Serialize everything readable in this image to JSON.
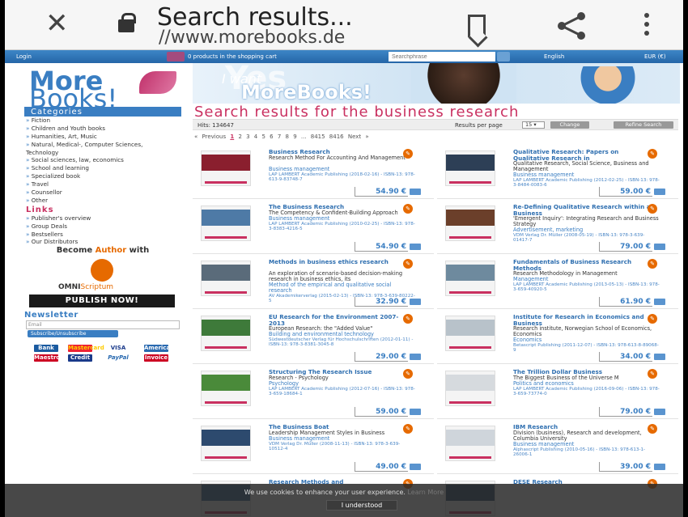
{
  "browser": {
    "title": "Search results...",
    "url": "//www.morebooks.de"
  },
  "topbar": {
    "login": "Login",
    "cart_text": "0 products in the shopping cart",
    "search_placeholder": "Searchphrase",
    "language": "English",
    "currency": "EUR (€)"
  },
  "logo": {
    "line1": "More",
    "line2": "Books!"
  },
  "banner": {
    "line1": "I want",
    "line2": "MoreBooks!",
    "bg_text": "Yes"
  },
  "sidebar": {
    "categories_title": "Categories",
    "categories": [
      "Fiction",
      "Children and Youth books",
      "Humanities, Art, Music",
      "Natural, Medical-, Computer Sciences, Technology",
      "Social sciences, law, economics",
      "School and learning",
      "Specialized book",
      "Travel",
      "Counsellor",
      "Other"
    ],
    "links_title": "Links",
    "links": [
      "Publisher's overview",
      "Group Deals",
      "Bestsellers",
      "Our Distributors"
    ],
    "become_prefix": "Become ",
    "become_accent": "Author",
    "become_suffix": " with",
    "omni_a": "OMNI",
    "omni_b": "Scriptum",
    "publish": "PUBLISH NOW!",
    "newsletter_title": "Newsletter",
    "email_placeholder": "Email",
    "subscribe": "Subscribe/Unsubscribe",
    "payments": [
      "Bank Transfer",
      "Mastercard",
      "VISA",
      "American Express",
      "Maestro",
      "Credit Card",
      "PayPal",
      "Invoice"
    ]
  },
  "main": {
    "heading": "Search results for the business research",
    "hits": "Hits: 134647",
    "results_per_page_label": "Results per page",
    "results_per_page": "15",
    "change": "Change",
    "refine": "Refine Search",
    "pager": {
      "prev": "« Previous",
      "current": "1",
      "pages": "2  3  4  5  6  7  8  9  ...  8415  8416",
      "next": "Next »"
    },
    "books": [
      {
        "title": "Business Research",
        "subtitle": "Research Method For Accounting And Management",
        "category": "Business management",
        "meta": "LAP LAMBERT Academic Publishing (2018-02-16) - ISBN-13: 978-613-9-83748-7",
        "price": "54.90 €",
        "color": "#8a1f2e"
      },
      {
        "title": "Qualitative Research: Papers on Qualitative Research in",
        "subtitle": "Qualitative Research, Social Science, Business and Management",
        "category": "Business management",
        "meta": "LAP LAMBERT Academic Publishing (2012-02-25) - ISBN-13: 978-3-8484-0083-6",
        "price": "59.00 €",
        "color": "#2d3f56"
      },
      {
        "title": "The Business Research",
        "subtitle": "The Competency & Confident-Building Approach",
        "category": "Business management",
        "meta": "LAP LAMBERT Academic Publishing (2010-02-25) - ISBN-13: 978-3-8383-4216-5",
        "price": "54.90 €",
        "color": "#4e7aa6"
      },
      {
        "title": "Re-Defining Qualitative Research within a Business",
        "subtitle": "'Emergent Inquiry': Integrating Research and Business Strategy",
        "category": "Advertisement, marketing",
        "meta": "VDM Verlag Dr. Müller (2008-05-19) - ISBN-13: 978-3-639-01417-7",
        "price": "79.00 €",
        "color": "#6b3f2a"
      },
      {
        "title": "Methods in business ethics research",
        "subtitle": "An exploration of scenario-based decision-making research in business ethics, its",
        "category": "Method of the empirical and qualitative social research",
        "meta": "AV Akademikerverlag (2015-02-13) - ISBN-13: 978-3-639-80222-5",
        "price": "32.90 €",
        "color": "#5a6b7a"
      },
      {
        "title": "Fundamentals of Business Research Methods",
        "subtitle": "Research Methodology in Management",
        "category": "Management",
        "meta": "LAP LAMBERT Academic Publishing (2013-05-13) - ISBN-13: 978-3-659-40920-5",
        "price": "61.90 €",
        "color": "#6e8a9e"
      },
      {
        "title": "EU Research for the Environment 2007-2013",
        "subtitle": "European Research: the \"Added Value\"",
        "category": "Building and environmental technology",
        "meta": "Südwestdeutscher Verlag für Hochschulschriften (2012-01-11) - ISBN-13: 978-3-8381-3045-8",
        "price": "29.00 €",
        "color": "#3e7a3a"
      },
      {
        "title": "Institute for Research in Economics and Business",
        "subtitle": "Research institute, Norwegian School of Economics, Economics",
        "category": "Economics",
        "meta": "Betascript Publishing (2011-12-07) - ISBN-13: 978-613-8-89068-9",
        "price": "34.00 €",
        "color": "#b8c2ca"
      },
      {
        "title": "Structuring The Research Issue",
        "subtitle": "Research - Psychology",
        "category": "Psychology",
        "meta": "LAP LAMBERT Academic Publishing (2012-07-16) - ISBN-13: 978-3-659-18684-1",
        "price": "59.00 €",
        "color": "#4a8a3a"
      },
      {
        "title": "The Trillion Dollar Business",
        "subtitle": "The Biggest Business of the Universe M",
        "category": "Politics and economics",
        "meta": "LAP LAMBERT Academic Publishing (2016-09-06) - ISBN-13: 978-3-659-73774-0",
        "price": "79.00 €",
        "color": "#d6dade"
      },
      {
        "title": "The Business Boat",
        "subtitle": "Leadership Management Styles in Business",
        "category": "Business management",
        "meta": "VDM Verlag Dr. Müller (2008-11-13) - ISBN-13: 978-3-639-10512-4",
        "price": "49.00 €",
        "color": "#2d4a6e"
      },
      {
        "title": "IBM Research",
        "subtitle": "Division (business), Research and development, Columbia University",
        "category": "Business management",
        "meta": "Alphascript Publishing (2010-05-16) - ISBN-13: 978-613-1-26006-1",
        "price": "39.00 €",
        "color": "#cfd5db"
      },
      {
        "title": "Research Methods and",
        "subtitle": "",
        "category": "",
        "meta": "",
        "price": "",
        "color": "#3a6a9a"
      },
      {
        "title": "DESE Research",
        "subtitle": "",
        "category": "",
        "meta": "",
        "price": "",
        "color": "#2d4a6e"
      }
    ]
  },
  "cookie": {
    "message": "We use cookies to enhance your user experience.",
    "learn_more": "Learn More",
    "button": "I understood"
  }
}
